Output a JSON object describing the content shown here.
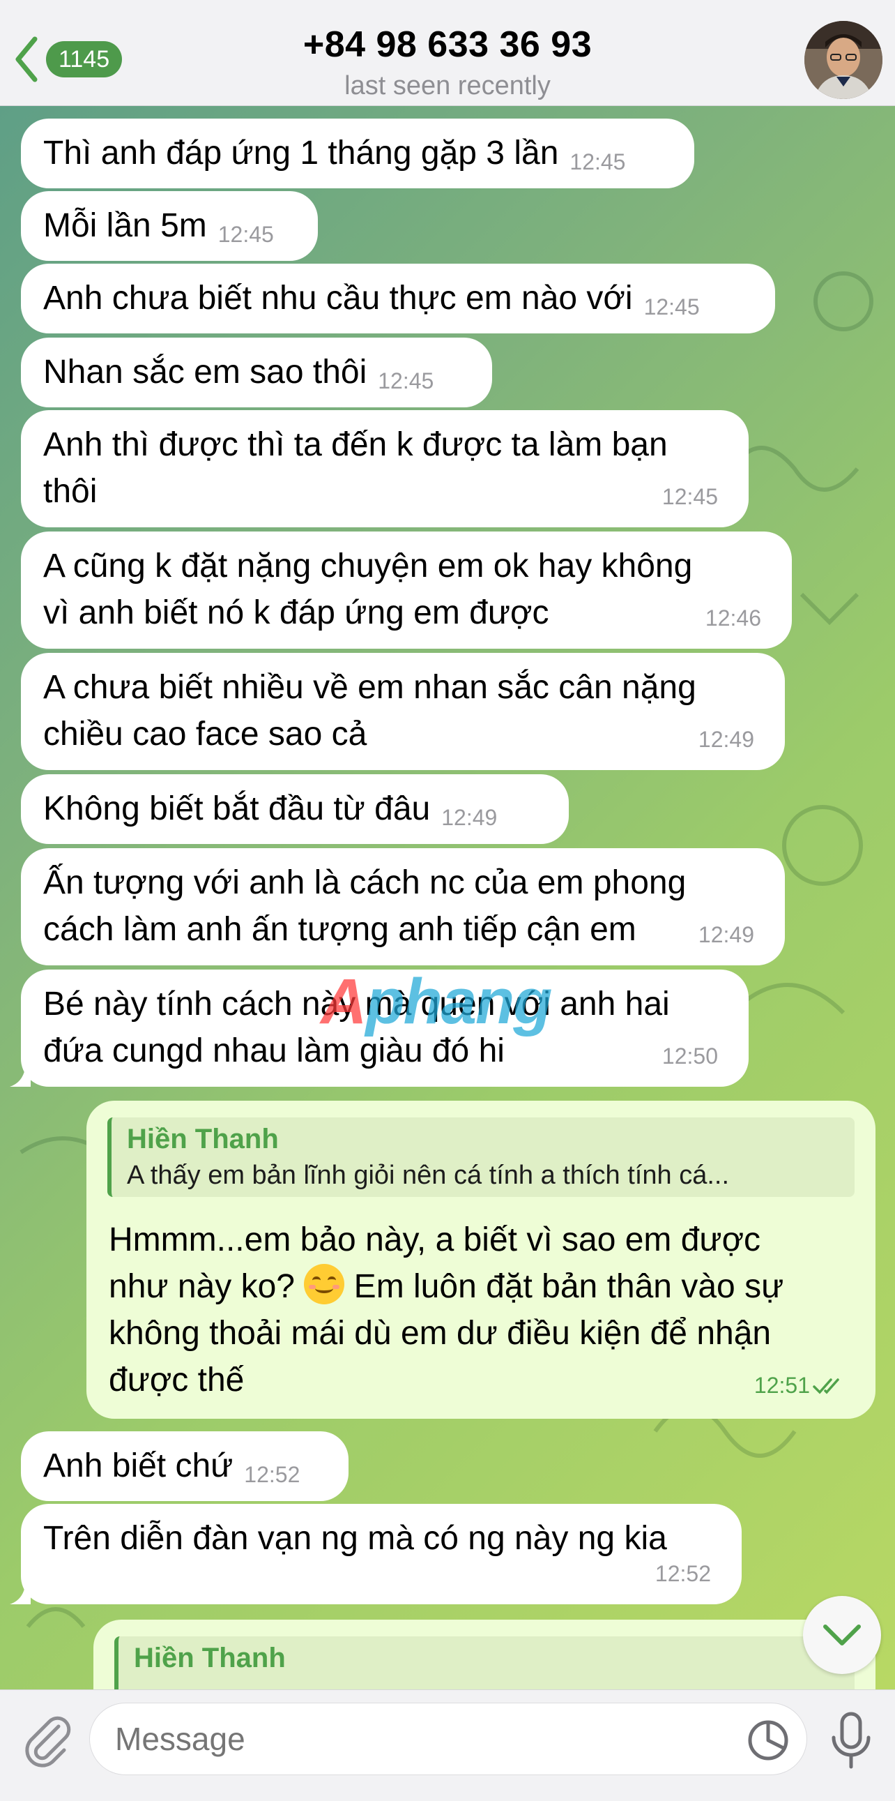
{
  "header": {
    "back_count": "1145",
    "title": "+84 98 633 36 93",
    "status": "last seen recently"
  },
  "messages": [
    {
      "text": "Thì anh đáp ứng 1 tháng gặp 3 lần",
      "time": "12:45"
    },
    {
      "text": "Mỗi lần 5m",
      "time": "12:45"
    },
    {
      "text": "Anh chưa biết nhu cầu thực em nào với",
      "time": "12:45"
    },
    {
      "text": "Nhan sắc em sao thôi",
      "time": "12:45"
    },
    {
      "line1": "Anh thì được thì ta đến k được ta làm bạn",
      "line2": "thôi",
      "time": "12:45"
    },
    {
      "line1": "A cũng k đặt nặng chuyện em ok hay không",
      "line2": "vì anh biết nó k đáp ứng em được",
      "time": "12:46"
    },
    {
      "line1": "A chưa biết nhiều về em nhan sắc cân nặng",
      "line2": "chiều cao face sao cả",
      "time": "12:49"
    },
    {
      "text": "Không biết bắt đầu từ đâu",
      "time": "12:49"
    },
    {
      "line1": "Ấn tượng với anh là cách nc của em phong",
      "line2": "cách làm anh ấn tượng anh tiếp cận em",
      "time": "12:49"
    },
    {
      "line1": "Bé này tính cách này mà quen với anh hai",
      "line2": "đứa cungd nhau làm giàu đó hi",
      "time": "12:50"
    }
  ],
  "outgoing": {
    "reply_author": "Hiền Thanh",
    "reply_text": "A thấy em bản lĩnh giỏi nên cá tính a thích tính cá...",
    "line1": "Hmmm...em bảo này, a biết vì sao em được",
    "line2a": "như này ko?",
    "line2b": "Em luôn đặt bản thân vào sự",
    "line3": "không thoải mái dù em dư điều kiện để nhận",
    "line4": "được thế",
    "time": "12:51",
    "emoji": "smiling-face"
  },
  "messages2": [
    {
      "text": "Anh biết chứ",
      "time": "12:52"
    },
    {
      "text": "Trên diễn đàn vạn ng mà có ng này ng kia",
      "time": "12:52"
    }
  ],
  "partial_outgoing": {
    "reply_author": "Hiền Thanh"
  },
  "watermark": {
    "part1": "A",
    "part2": "phang"
  },
  "composer": {
    "placeholder": "Message"
  },
  "colors": {
    "accent": "#4fa24a",
    "badge": "#4e9a4b",
    "outgoing_bubble": "#eefdd6",
    "header_bg": "#f2f2f4"
  }
}
